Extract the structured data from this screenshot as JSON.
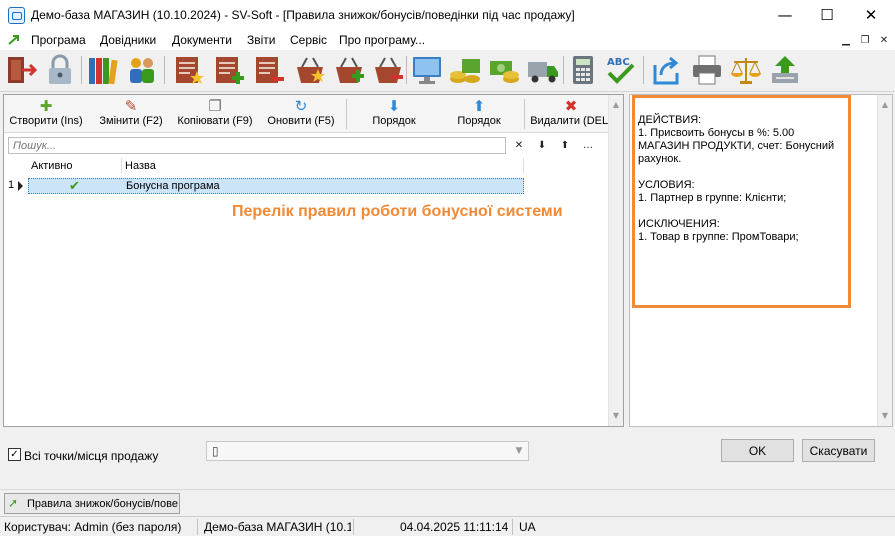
{
  "window": {
    "title": "Демо-база МАГАЗИН (10.10.2024) - SV-Soft  - [Правила знижок/бонусів/поведінки під час продажу]",
    "minimize": "—",
    "maximize": "☐",
    "close": "✕"
  },
  "menu": {
    "items": [
      "Програма",
      "Довідники",
      "Документи",
      "Звіти",
      "Сервіс",
      "Про програму..."
    ]
  },
  "toolbar": {
    "icons": [
      "exit-door-icon",
      "lock-icon",
      "books-icon",
      "users-icon",
      "doc-star-icon",
      "doc-add-icon",
      "doc-remove-icon",
      "basket-star-icon",
      "basket-add-icon",
      "basket-remove-icon",
      "monitor-icon",
      "cash-register-icon",
      "money-icon",
      "truck-icon",
      "calculator-icon",
      "spellcheck-icon",
      "export-icon",
      "printer-icon",
      "scales-icon",
      "upload-icon"
    ]
  },
  "commands": {
    "create": {
      "label": "Створити (Ins)",
      "icon": "✚"
    },
    "edit": {
      "label": "Змінити (F2)",
      "icon": "✎"
    },
    "copy": {
      "label": "Копіювати (F9)",
      "icon": "❐"
    },
    "refresh": {
      "label": "Оновити (F5)",
      "icon": "↻"
    },
    "order_down": {
      "label": "Порядок",
      "icon": "⬇"
    },
    "order_up": {
      "label": "Порядок",
      "icon": "⬆"
    },
    "delete": {
      "label": "Видалити (DEL)",
      "icon": "✖"
    }
  },
  "search": {
    "placeholder": "Пошук...",
    "clear": "✕",
    "down": "⬇",
    "up": "⬆",
    "more": "…"
  },
  "grid": {
    "columns": [
      "Активно",
      "Назва"
    ],
    "rows": [
      {
        "num": "1",
        "active": "✔",
        "name": "Бонусна програма"
      }
    ]
  },
  "annotation": "Перелік правил роботи бонусної системи",
  "rule_details": "ДЕЙСТВИЯ:\n1. Присвоить бонусы в %: 5.00\nМАГАЗИН ПРОДУКТИ, счет: Бонусний рахунок.\n\nУСЛОВИЯ:\n1. Партнер в группе: Клієнти;\n\nИСКЛЮЧЕНИЯ:\n1. Товар в группе: ПромТовари;",
  "bottom": {
    "all_points_label": "Всі точки/місця продажу",
    "checkbox": "✓",
    "combo_value": "▯",
    "combo_arrow": "▼",
    "ok": "OK",
    "cancel": "Скасувати"
  },
  "taskbar": {
    "item": "Правила знижок/бонусів/пове"
  },
  "status": {
    "user": "Користувач: Admin (без пароля)",
    "db": "Демо-база МАГАЗИН (10.1",
    "datetime": "04.04.2025 11:11:14",
    "lang": "UA"
  },
  "colors": {
    "accent_orange": "#f08a36",
    "selection": "#cce4f7",
    "check_green": "#3a9a1e"
  }
}
